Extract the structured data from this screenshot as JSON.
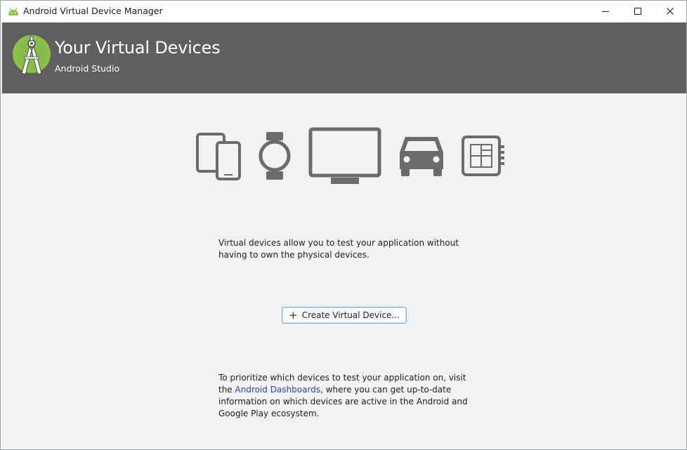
{
  "window": {
    "title": "Android Virtual Device Manager",
    "controls": {
      "minimize": "minimize",
      "maximize": "maximize",
      "close": "close"
    }
  },
  "header": {
    "title": "Your Virtual Devices",
    "subtitle": "Android Studio",
    "background": "#5f5f5f"
  },
  "device_icons": [
    "phone-tablet-icon",
    "wear-watch-icon",
    "tv-icon",
    "car-icon",
    "things-chip-icon"
  ],
  "intro": {
    "text": "Virtual devices allow you to test your application without having to own the physical devices."
  },
  "create_button": {
    "plus": "+",
    "label": "Create Virtual Device..."
  },
  "footer": {
    "text_before": "To prioritize which devices to test your application on, visit the ",
    "link": "Android Dashboards",
    "text_after": ", where you can get up-to-date information on which devices are active in the Android and Google Play ecosystem.",
    "link_color": "#2845c4"
  },
  "colors": {
    "icon_gray": "#6b6b6b",
    "android_green": "#8bc34a",
    "body_bg": "#f2f2f2"
  }
}
